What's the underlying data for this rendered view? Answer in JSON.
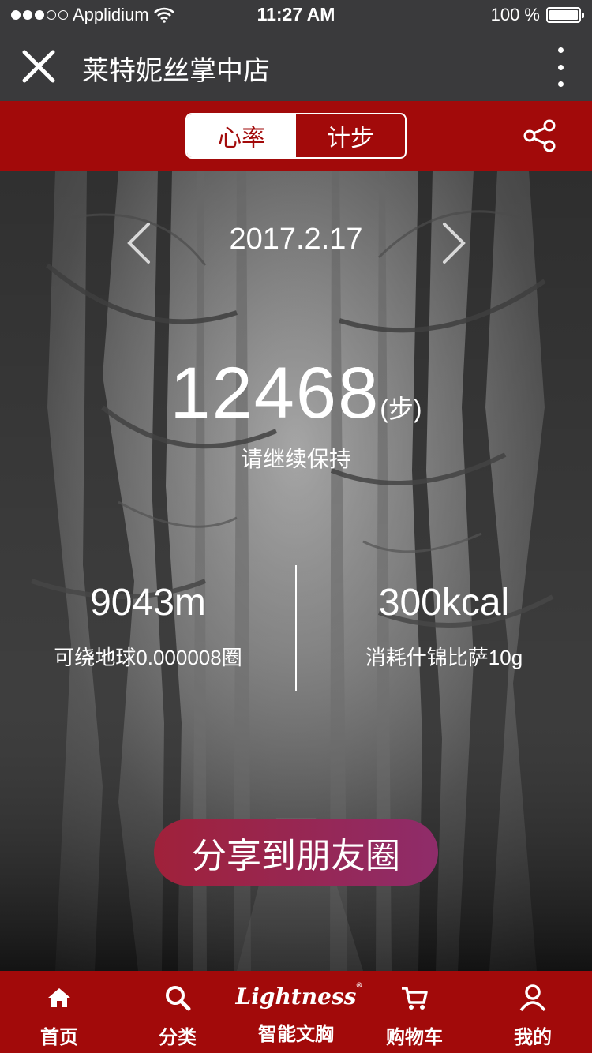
{
  "status_bar": {
    "carrier": "Applidium",
    "time": "11:27 AM",
    "battery": "100 %"
  },
  "header": {
    "title": "莱特妮丝掌中店"
  },
  "tabs": [
    {
      "label": "心率",
      "active": true
    },
    {
      "label": "计步",
      "active": false
    }
  ],
  "main": {
    "date": "2017.2.17",
    "steps": "12468",
    "steps_unit": "(步)",
    "encouragement": "请继续保持",
    "distance": {
      "value": "9043m",
      "desc": "可绕地球0.000008圈"
    },
    "calories": {
      "value": "300kcal",
      "desc": "消耗什锦比萨10g"
    },
    "share_button": "分享到朋友圈"
  },
  "bottom_nav": {
    "logo_text": "Lightness",
    "logo_mark": "®",
    "items": [
      {
        "label": "首页",
        "icon": "home-icon"
      },
      {
        "label": "分类",
        "icon": "search-icon"
      },
      {
        "label": "智能文胸",
        "icon": "brand-logo"
      },
      {
        "label": "购物车",
        "icon": "cart-icon"
      },
      {
        "label": "我的",
        "icon": "user-icon"
      }
    ]
  },
  "colors": {
    "brand_red": "#a20a0a",
    "header_gray": "#3a3a3c",
    "share_gradient_start": "#a0213a",
    "share_gradient_end": "#8f2c6a"
  }
}
